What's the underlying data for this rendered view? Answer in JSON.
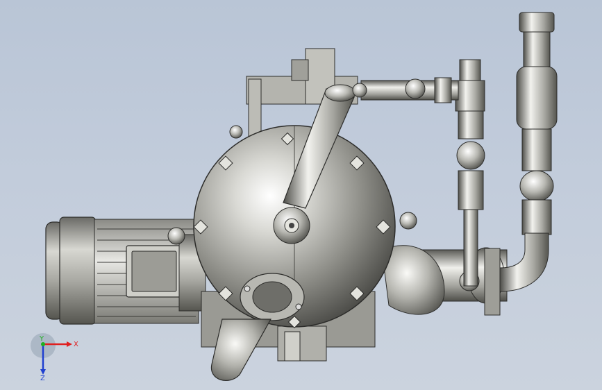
{
  "viewport": {
    "background_top": "#b9c5d6",
    "background_bottom": "#cbd3de",
    "model": "pump-assembly-isometric-render"
  },
  "triad": {
    "x_label": "X",
    "y_label": "Y",
    "z_label": "Z",
    "x_color": "#e02020",
    "y_color": "#20b020",
    "z_color": "#2040d0"
  }
}
